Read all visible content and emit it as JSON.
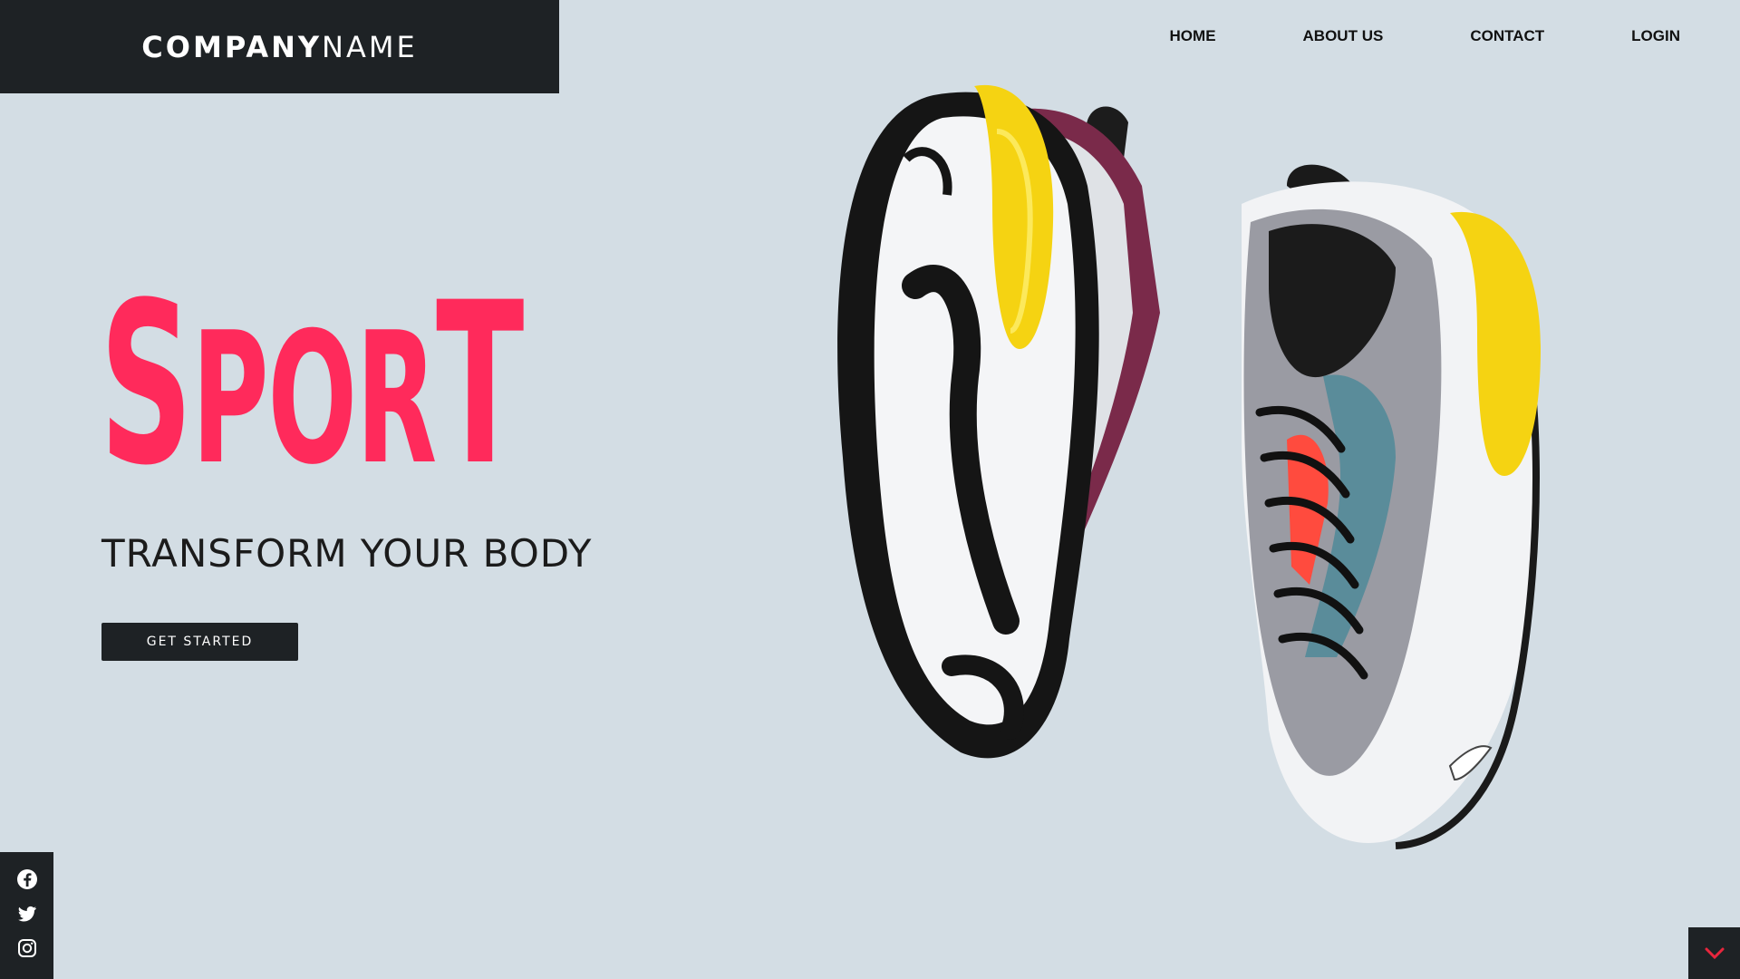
{
  "brand": {
    "bold": "COMPANY",
    "light": "NAME"
  },
  "nav": {
    "items": [
      {
        "label": "HOME"
      },
      {
        "label": "ABOUT US"
      },
      {
        "label": "CONTACT"
      },
      {
        "label": "LOGIN"
      }
    ]
  },
  "hero": {
    "title_parts": [
      "S",
      "POR",
      "T"
    ],
    "subtitle": "TRANSFORM YOUR BODY",
    "cta_label": "GET STARTED"
  },
  "social": {
    "icons": [
      "facebook-icon",
      "twitter-icon",
      "instagram-icon"
    ]
  },
  "scroll": {
    "icon": "chevron-down-icon"
  },
  "colors": {
    "background": "#d3dde4",
    "dark": "#1e2225",
    "accent": "#ff2a5b",
    "scroll_chevron": "#e8263d"
  }
}
